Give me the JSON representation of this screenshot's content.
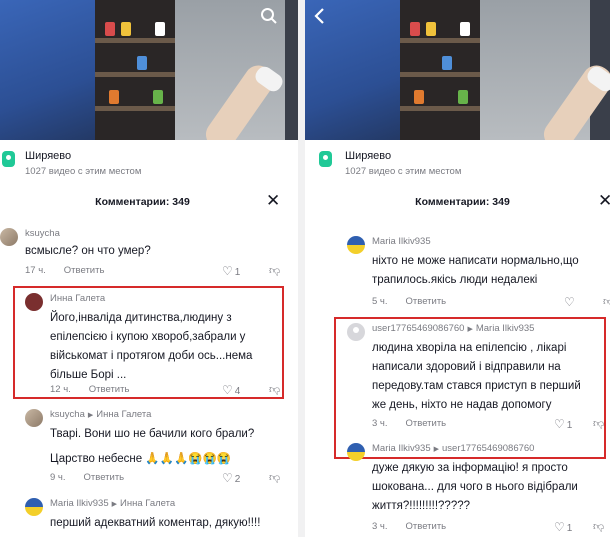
{
  "left": {
    "location": {
      "name": "Ширяево",
      "subtitle": "1027 видео с этим местом"
    },
    "comments_title": "Комментарии: 349",
    "comments": [
      {
        "author": "ksuycha",
        "reply_to": "",
        "text": [
          "всмысле? он что умер?"
        ],
        "time": "17 ч.",
        "reply_label": "Ответить",
        "likes": "1"
      },
      {
        "author": "Инна Галета",
        "reply_to": "",
        "text": [
          "Його,інваліда дитинства,людину з",
          "епілепсією і купою хвороб,забрали у",
          "військомат і протягом доби ось...нема",
          "більше Борі ..."
        ],
        "time": "12 ч.",
        "reply_label": "Ответить",
        "likes": "4"
      },
      {
        "author": "ksuycha",
        "reply_to": "Инна Галета",
        "text": [
          "Тварі. Вони шо не бачили кого брали?",
          "Царство небесне 🙏🙏🙏😭😭😭"
        ],
        "time": "9 ч.",
        "reply_label": "Ответить",
        "likes": "2"
      },
      {
        "author": "Maria Ilkiv935",
        "reply_to": "Инна Галета",
        "text": [
          "перший адекватний коментар, дякую!!!!"
        ],
        "time": "",
        "reply_label": "",
        "likes": ""
      }
    ]
  },
  "right": {
    "location": {
      "name": "Ширяево",
      "subtitle": "1027 видео с этим местом"
    },
    "comments_title": "Комментарии: 349",
    "comments": [
      {
        "author": "Maria Ilkiv935",
        "reply_to": "",
        "text": [
          "ніхто не може написати нормально,що",
          "трапилось.якісь люди недалекі"
        ],
        "time": "5 ч.",
        "reply_label": "Ответить",
        "likes": ""
      },
      {
        "author": "user17765469086760",
        "reply_to": "Maria Ilkiv935",
        "text": [
          "людина хворіла на епілепсію , лікарі",
          "написали здоровий і відправили на",
          "передову.там стався приступ в перший",
          "же день, ніхто не надав допомогу"
        ],
        "time": "3 ч.",
        "reply_label": "Ответить",
        "likes": "1"
      },
      {
        "author": "Maria Ilkiv935",
        "reply_to": "user17765469086760",
        "text": [
          "дуже дякую за інформацію! я просто",
          "шокована... для чого в нього відібрали",
          "життя?!!!!!!!!!?????"
        ],
        "time": "3 ч.",
        "reply_label": "Ответить",
        "likes": "1"
      }
    ]
  },
  "colors": {
    "highlight_border": "#d62a2a",
    "location_icon": "#20c997",
    "muted_text": "#7a7b82"
  },
  "icons": {
    "back": "chevron-left-icon",
    "search": "search-icon",
    "close": "close-icon",
    "like": "heart-icon",
    "dislike": "dislike-icon",
    "location": "location-pin-icon"
  }
}
